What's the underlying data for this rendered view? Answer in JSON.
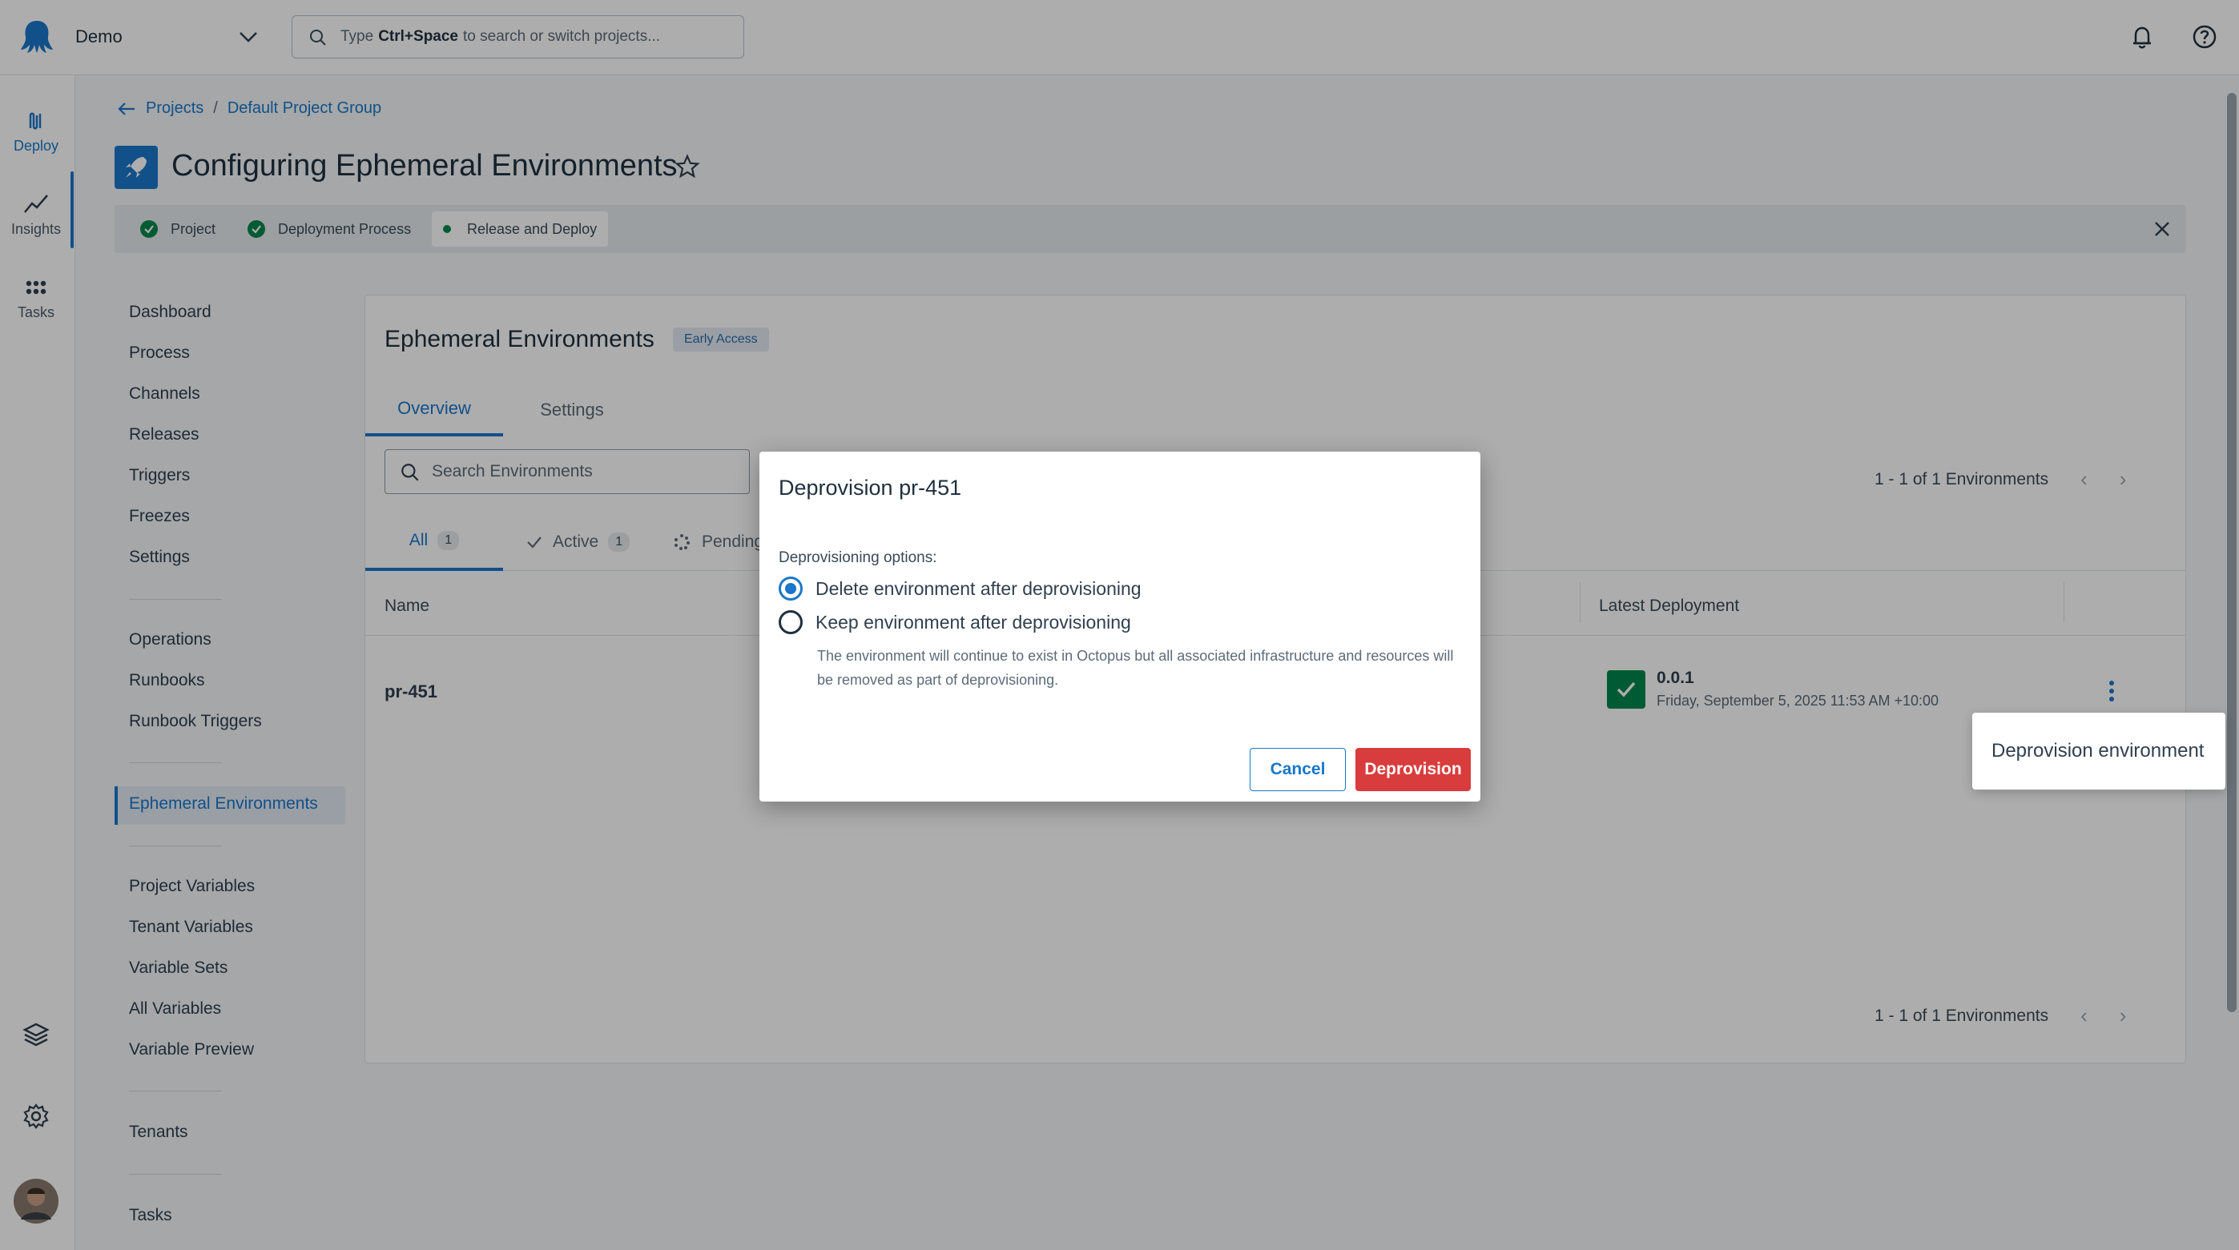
{
  "topbar": {
    "space_name": "Demo",
    "search_prefix": "Type",
    "search_shortcut": "Ctrl+Space",
    "search_suffix": "to search or switch projects..."
  },
  "rail": {
    "items": [
      {
        "label": "Deploy",
        "icon": "deploy-icon"
      },
      {
        "label": "Insights",
        "icon": "insights-icon"
      },
      {
        "label": "Tasks",
        "icon": "tasks-icon"
      }
    ]
  },
  "breadcrumb": {
    "back_label": "Projects",
    "group_label": "Default Project Group"
  },
  "page": {
    "title": "Configuring Ephemeral Environments"
  },
  "stepper": {
    "steps": [
      "Project",
      "Deployment Process",
      "Release and Deploy"
    ]
  },
  "sidenav": {
    "items": [
      "Dashboard",
      "Process",
      "Channels",
      "Releases",
      "Triggers",
      "Freezes",
      "Settings",
      "Operations",
      "Runbooks",
      "Runbook Triggers",
      "Ephemeral Environments",
      "Project Variables",
      "Tenant Variables",
      "Variable Sets",
      "All Variables",
      "Variable Preview",
      "Tenants",
      "Tasks"
    ]
  },
  "panel": {
    "title": "Ephemeral Environments",
    "badge": "Early Access",
    "tabs": [
      "Overview",
      "Settings"
    ],
    "search_placeholder": "Search Environments",
    "pager_text": "1 - 1 of 1 Environments",
    "filters": [
      {
        "label": "All",
        "count": "1"
      },
      {
        "label": "Active",
        "count": "1"
      },
      {
        "label": "Pending"
      }
    ],
    "columns": {
      "name": "Name",
      "latest": "Latest Deployment"
    },
    "rows": [
      {
        "name": "pr-451",
        "version": "0.0.1",
        "date": "Friday, September 5, 2025 11:53 AM +10:00"
      }
    ]
  },
  "context_menu": {
    "item": "Deprovision environment"
  },
  "dialog": {
    "title": "Deprovision pr-451",
    "options_label": "Deprovisioning options:",
    "option_delete": "Delete environment after deprovisioning",
    "option_keep": "Keep environment after deprovisioning",
    "helper": "The environment will continue to exist in Octopus but all associated infrastructure and resources will be removed as part of deprovisioning.",
    "selected_option": "Delete environment after deprovisioning",
    "cancel_label": "Cancel",
    "confirm_label": "Deprovision"
  },
  "colors": {
    "accent": "#1a77ca",
    "success": "#00874d",
    "danger": "#d93c3c"
  }
}
